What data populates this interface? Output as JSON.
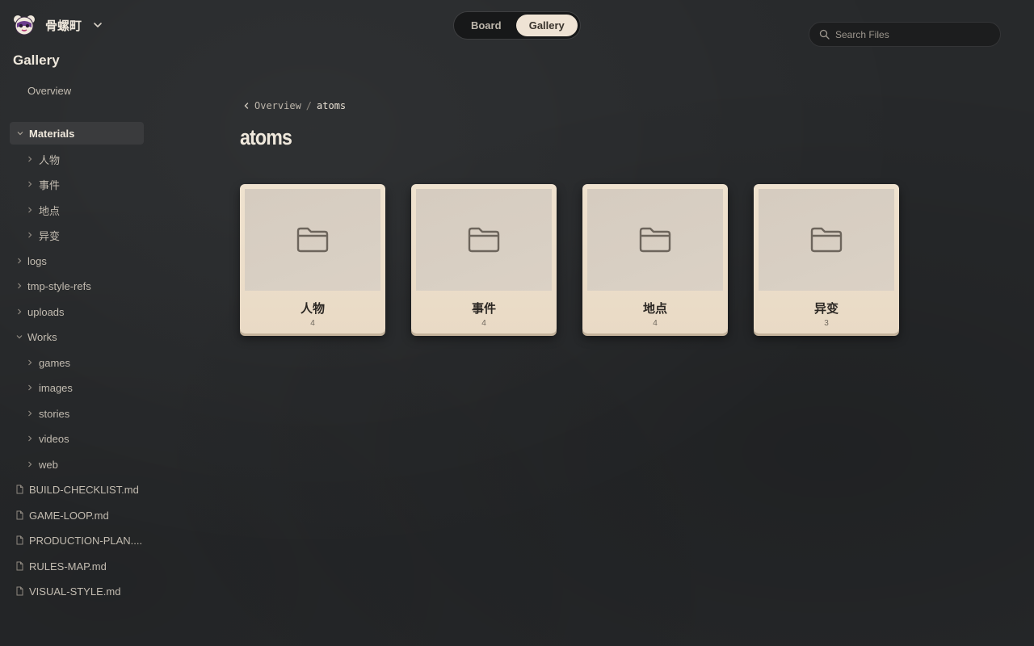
{
  "workspace": {
    "name": "骨螺町",
    "logo_icon": "masked-face-logo"
  },
  "sidebar": {
    "title": "Gallery",
    "overview": "Overview",
    "materials": {
      "label": "Materials",
      "children": [
        "人物",
        "事件",
        "地点",
        "异变"
      ]
    },
    "folders": [
      "logs",
      "tmp-style-refs",
      "uploads"
    ],
    "works": {
      "label": "Works",
      "children": [
        "games",
        "images",
        "stories",
        "videos",
        "web"
      ]
    },
    "files": [
      "BUILD-CHECKLIST.md",
      "GAME-LOOP.md",
      "PRODUCTION-PLAN....",
      "RULES-MAP.md",
      "VISUAL-STYLE.md"
    ]
  },
  "view_toggle": {
    "board": "Board",
    "gallery": "Gallery",
    "active": "gallery"
  },
  "search": {
    "placeholder": "Search Files",
    "value": ""
  },
  "breadcrumb": {
    "parent": "Overview",
    "separator": "/",
    "current": "atoms"
  },
  "page": {
    "title": "atoms"
  },
  "cards": [
    {
      "name": "人物",
      "count": "4",
      "icon": "folder-icon"
    },
    {
      "name": "事件",
      "count": "4",
      "icon": "folder-icon"
    },
    {
      "name": "地点",
      "count": "4",
      "icon": "folder-icon"
    },
    {
      "name": "异变",
      "count": "3",
      "icon": "folder-icon"
    }
  ],
  "colors": {
    "background": "#27292b",
    "accent": "#efe3d4",
    "card": "#efe2cf",
    "text": "#cfc8bd"
  }
}
